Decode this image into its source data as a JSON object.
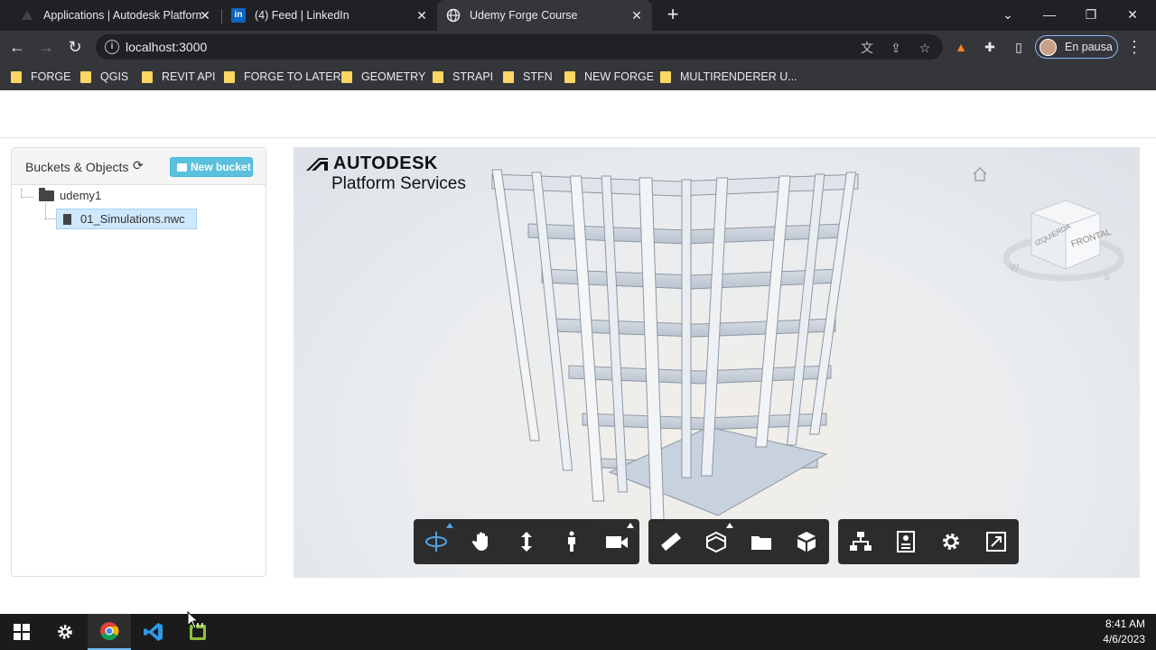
{
  "browser": {
    "tabs": [
      {
        "title": "Applications | Autodesk Platform",
        "icon": "autodesk-icon"
      },
      {
        "title": "(4) Feed | LinkedIn",
        "icon": "linkedin-icon"
      },
      {
        "title": "Udemy Forge Course",
        "icon": "globe-icon",
        "active": true
      }
    ],
    "url": "localhost:3000",
    "profile_status": "En pausa",
    "bookmarks": [
      "FORGE",
      "QGIS",
      "REVIT API",
      "FORGE TO LATER",
      "GEOMETRY",
      "STRAPI",
      "STFN",
      "NEW FORGE",
      "MULTIRENDERER U..."
    ]
  },
  "sidebar": {
    "title": "Buckets & Objects",
    "new_bucket_label": "New bucket",
    "bucket_name": "udemy1",
    "object_name": "01_Simulations.nwc"
  },
  "viewer": {
    "logo_brand": "AUTODESK",
    "logo_sub": "Platform Services",
    "viewcube_face": "FRONTAL",
    "viewcube_side": "IZQUIERDA",
    "compass_w": "W",
    "compass_s": "S",
    "toolbar_groups": [
      [
        "orbit-icon",
        "pan-icon",
        "dolly-icon",
        "first-person-icon",
        "camera-icon"
      ],
      [
        "measure-icon",
        "section-icon",
        "model-browser-icon",
        "explode-icon"
      ],
      [
        "structure-icon",
        "properties-icon",
        "settings-icon",
        "fullscreen-icon"
      ]
    ],
    "accent_color": "#4fa3e0"
  },
  "taskbar": {
    "time": "8:41 AM",
    "date": "4/6/2023",
    "apps": [
      "windows-start-icon",
      "settings-icon",
      "chrome-icon",
      "vscode-icon",
      "notepad-plus-icon"
    ]
  }
}
